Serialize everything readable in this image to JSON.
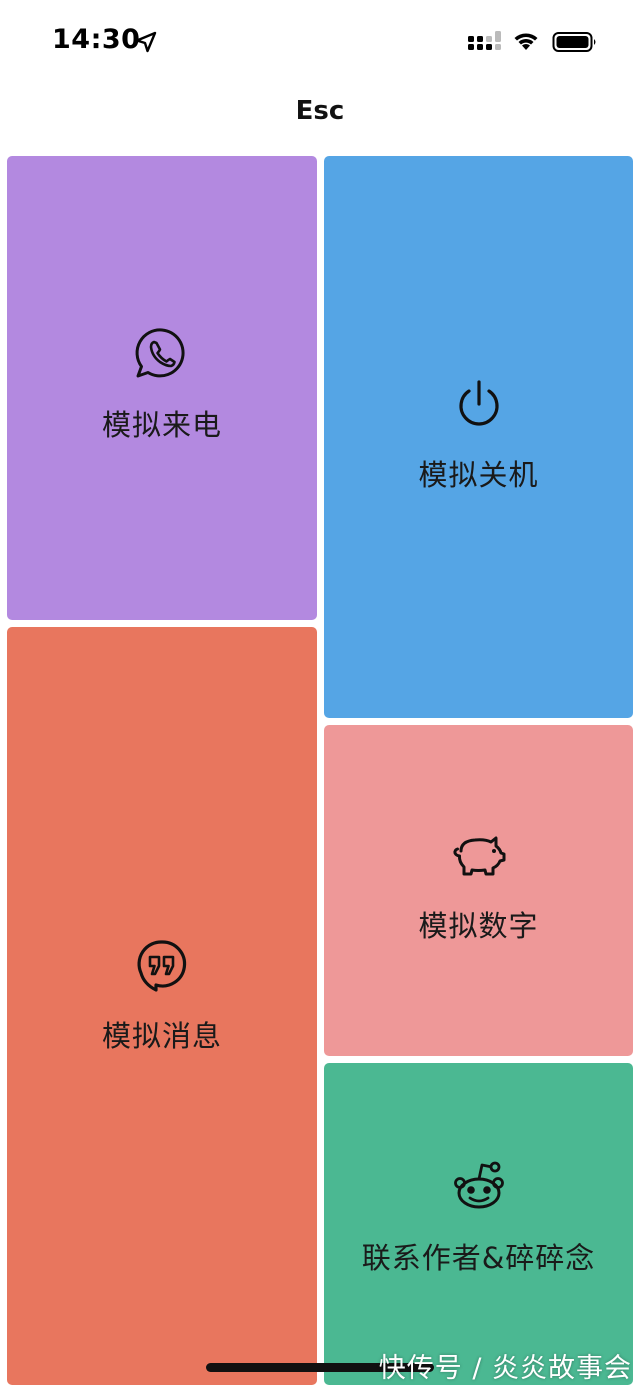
{
  "status_bar": {
    "time": "14:30",
    "icons": [
      "location-arrow-icon",
      "cellular-signal-icon",
      "wifi-icon",
      "battery-icon"
    ]
  },
  "nav": {
    "title": "Esc"
  },
  "tiles": [
    {
      "id": "call",
      "label": "模拟来电",
      "icon": "whatsapp-phone-icon",
      "color": "#b389e0"
    },
    {
      "id": "shutdown",
      "label": "模拟关机",
      "icon": "power-icon",
      "color": "#55a5e5"
    },
    {
      "id": "message",
      "label": "模拟消息",
      "icon": "quote-bubble-icon",
      "color": "#e8765e"
    },
    {
      "id": "number",
      "label": "模拟数字",
      "icon": "piggy-bank-icon",
      "color": "#ee9898"
    },
    {
      "id": "contact",
      "label": "联系作者&碎碎念",
      "icon": "reddit-alien-icon",
      "color": "#4bb892"
    }
  ],
  "watermark": "快传号 / 炎炎故事会"
}
